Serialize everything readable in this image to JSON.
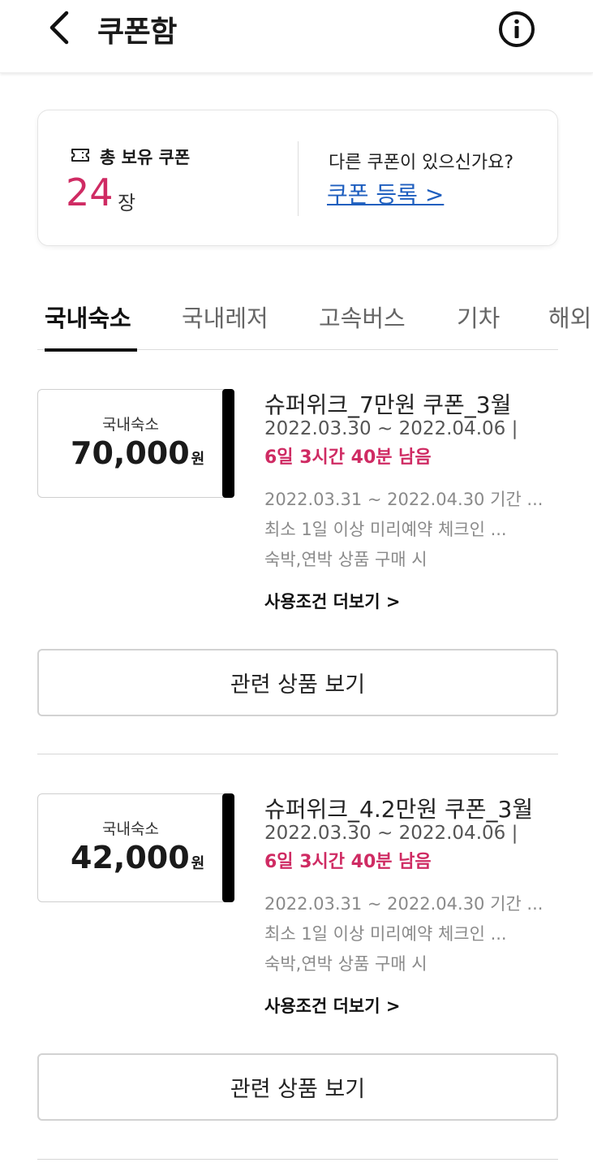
{
  "header": {
    "title": "쿠폰함",
    "back_icon": "chevron-left-icon",
    "info_icon": "info-circle-icon"
  },
  "summary": {
    "label": "총 보유 쿠폰",
    "count": "24",
    "unit": "장",
    "question": "다른 쿠폰이 있으신가요?",
    "register_link": "쿠폰 등록 >",
    "accent_color": "#cf2b63",
    "link_color": "#1f5fbf"
  },
  "tabs": [
    {
      "label": "국내숙소",
      "active": true
    },
    {
      "label": "국내레저",
      "active": false
    },
    {
      "label": "고속버스",
      "active": false
    },
    {
      "label": "기차",
      "active": false
    },
    {
      "label": "해외",
      "active": false
    }
  ],
  "coupons": [
    {
      "category": "국내숙소",
      "amount": "70,000",
      "currency": "원",
      "title": "슈퍼위크_7만원 쿠폰_3월",
      "period": "2022.03.30 ~ 2022.04.06  |",
      "remaining": "6일 3시간 40분 남음",
      "conditions": [
        "2022.03.31 ~ 2022.04.30 기간 ...",
        "최소 1일 이상 미리예약 체크인 ...",
        "숙박,연박 상품 구매 시"
      ],
      "more_label": "사용조건 더보기 >",
      "button_label": "관련 상품 보기"
    },
    {
      "category": "국내숙소",
      "amount": "42,000",
      "currency": "원",
      "title": "슈퍼위크_4.2만원 쿠폰_3월",
      "period": "2022.03.30 ~ 2022.04.06  |",
      "remaining": "6일 3시간 40분 남음",
      "conditions": [
        "2022.03.31 ~ 2022.04.30 기간 ...",
        "최소 1일 이상 미리예약 체크인 ...",
        "숙박,연박 상품 구매 시"
      ],
      "more_label": "사용조건 더보기 >",
      "button_label": "관련 상품 보기"
    }
  ]
}
